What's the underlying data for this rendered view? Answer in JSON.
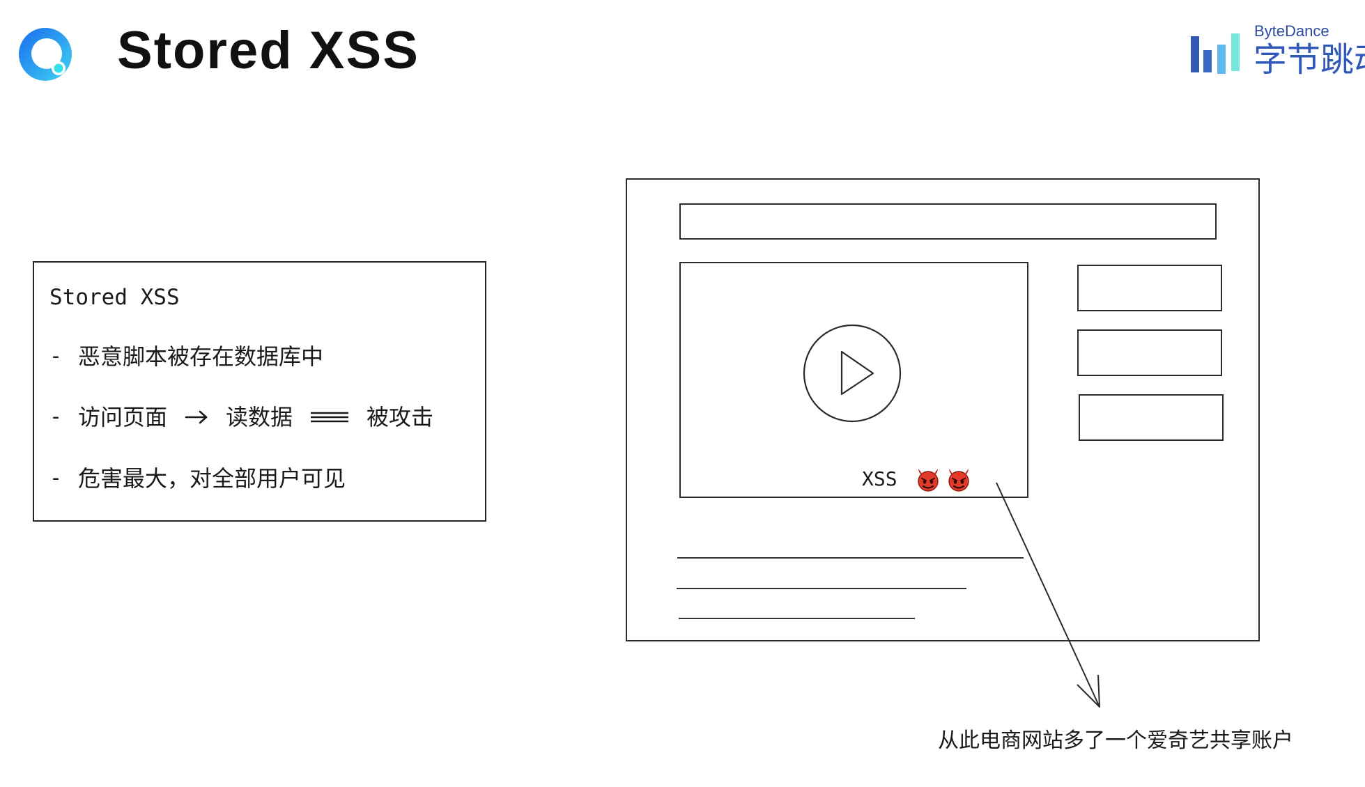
{
  "header": {
    "title": "Stored XSS",
    "logo_icon": "product-logo-icon"
  },
  "brand": {
    "name_en": "ByteDance",
    "name_cn": "字节跳动",
    "logo_icon": "bytedance-bars-icon"
  },
  "summary": {
    "heading": "Stored XSS",
    "bullet_marker": "-",
    "point1": "恶意脚本被存在数据库中",
    "flow": {
      "step1": "访问页面",
      "arrow_icon": "arrow-right-icon",
      "step2": "读数据",
      "equals_icon": "triple-bar-icon",
      "result": "被攻击"
    },
    "point3": "危害最大，对全部用户可见"
  },
  "mockup": {
    "play_icon": "play-icon",
    "video_label": "XSS",
    "badge_icon": "devil-icon",
    "badge_count": 2
  },
  "caption": "从此电商网站多了一个爱奇艺共享账户",
  "colors": {
    "logo_blue": "#1e7ff0",
    "logo_cyan": "#33d6e8",
    "brand_dark_blue": "#325ab4",
    "brand_cyan": "#78e6dc",
    "devil_red": "#e23a2a",
    "stroke": "#2a2a2a"
  }
}
